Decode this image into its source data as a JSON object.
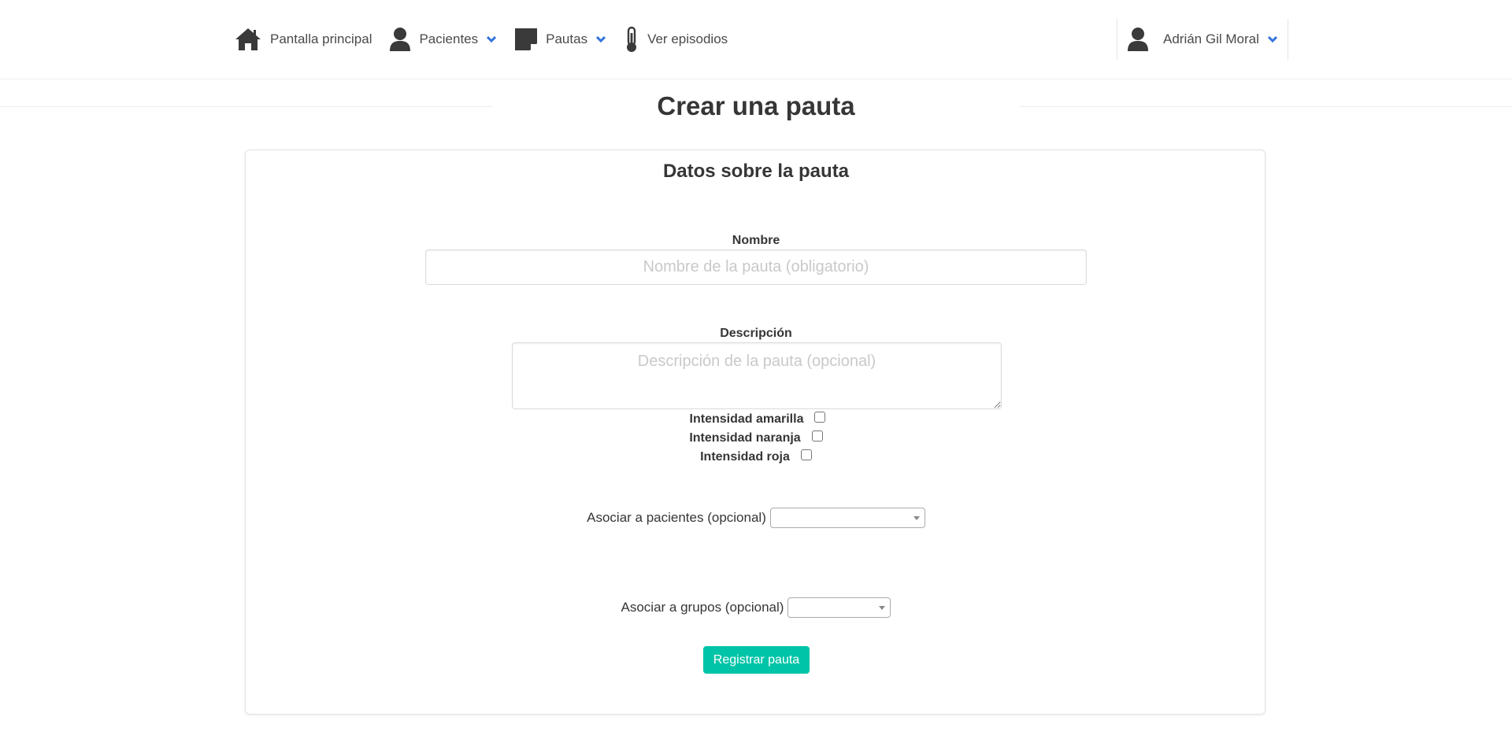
{
  "nav": {
    "items": [
      {
        "label": "Pantalla principal",
        "icon": "home-icon"
      },
      {
        "label": "Pacientes",
        "icon": "user-icon",
        "dropdown": true
      },
      {
        "label": "Pautas",
        "icon": "note-icon",
        "dropdown": true
      },
      {
        "label": "Ver episodios",
        "icon": "thermometer-icon"
      }
    ],
    "user": {
      "name": "Adrián Gil Moral",
      "icon": "user-icon"
    },
    "accent_color": "#3273dc"
  },
  "page": {
    "title": "Crear una pauta"
  },
  "form": {
    "section_title": "Datos sobre la pauta",
    "name": {
      "label": "Nombre",
      "placeholder": "Nombre de la pauta (obligatorio)",
      "value": ""
    },
    "description": {
      "label": "Descripción",
      "placeholder": "Descripción de la pauta (opcional)",
      "value": ""
    },
    "checks": [
      {
        "label": "Intensidad amarilla",
        "checked": false
      },
      {
        "label": "Intensidad naranja",
        "checked": false
      },
      {
        "label": "Intensidad roja",
        "checked": false
      }
    ],
    "patients": {
      "label": "Asociar a pacientes (opcional)",
      "selected": ""
    },
    "groups": {
      "label": "Asociar a grupos (opcional)",
      "selected": ""
    },
    "submit_label": "Registrar pauta",
    "submit_color": "#00c4a7"
  }
}
